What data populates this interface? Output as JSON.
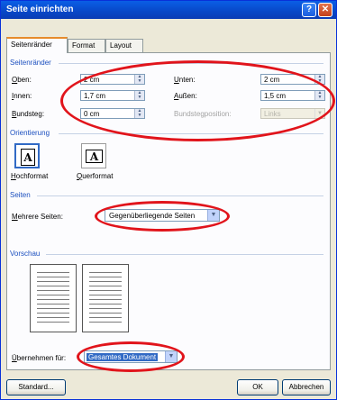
{
  "title": "Seite einrichten",
  "title_buttons": {
    "help": "?",
    "close": "✕"
  },
  "tabs": [
    "Seitenränder",
    "Format",
    "Layout"
  ],
  "margins": {
    "header": "Seitenränder",
    "oben_label": "Oben:",
    "oben_value": "2 cm",
    "unten_label": "Unten:",
    "unten_value": "2 cm",
    "innen_label": "Innen:",
    "innen_value": "1,7 cm",
    "aussen_label": "Außen:",
    "aussen_value": "1,5 cm",
    "bundsteg_label": "Bundsteg:",
    "bundsteg_value": "0 cm",
    "bundstegposition_label": "Bundstegposition:",
    "bundstegposition_value": "Links"
  },
  "orientation": {
    "header": "Orientierung",
    "hochformat_label": "Hochformat",
    "querformat_label": "Querformat",
    "glyph": "A",
    "selected": "Hochformat"
  },
  "pages": {
    "header": "Seiten",
    "mehrere_label": "Mehrere Seiten:",
    "mehrere_value": "Gegenüberliegende Seiten"
  },
  "preview": {
    "header": "Vorschau",
    "apply_label": "Übernehmen für:",
    "apply_value": "Gesamtes Dokument"
  },
  "buttons": {
    "standard": "Standard...",
    "ok": "OK",
    "cancel": "Abbrechen"
  },
  "icons": {
    "spinner": "up-down-arrows-icon",
    "dropdown": "chevron-down-icon",
    "portrait": "portrait-page-icon",
    "landscape": "landscape-page-icon"
  },
  "colors": {
    "titlebar": "#0a4fd6",
    "group_header": "#1b4fbf",
    "annotation": "#e1141b",
    "selection": "#316ac5"
  }
}
